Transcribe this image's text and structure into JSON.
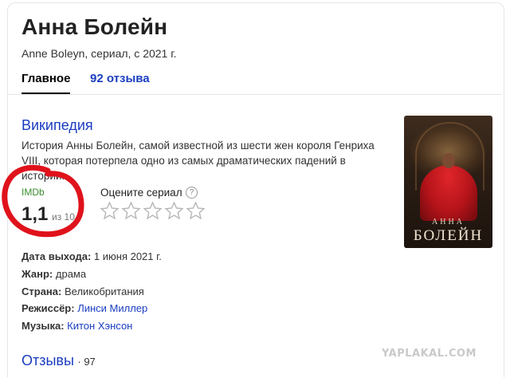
{
  "header": {
    "title": "Анна Болейн",
    "subtitle": "Anne Boleyn, сериал, с 2021 г."
  },
  "tabs": [
    {
      "label": "Главное",
      "active": true
    },
    {
      "label": "92 отзыва",
      "active": false
    }
  ],
  "wiki": {
    "link_label": "Википедия",
    "description": "История Анны Болейн, самой известной из шести жен короля Генриха VIII, которая потерпела одно из самых драматических падений в истории."
  },
  "poster": {
    "line1": "АННА",
    "line2": "БОЛЕЙН"
  },
  "rating": {
    "source": "IMDb",
    "score": "1,1",
    "out_of": "из 10"
  },
  "user_rating": {
    "label": "Оцените сериал",
    "help_icon": "question-circle-icon",
    "max_stars": 5,
    "selected": 0
  },
  "facts": [
    {
      "label": "Дата выхода:",
      "value": "1 июня 2021 г.",
      "link": false
    },
    {
      "label": "Жанр:",
      "value": "драма",
      "link": false
    },
    {
      "label": "Страна:",
      "value": "Великобритания",
      "link": false
    },
    {
      "label": "Режиссёр:",
      "value": "Линси Миллер",
      "link": true
    },
    {
      "label": "Музыка:",
      "value": "Китон Хэнсон",
      "link": true
    }
  ],
  "reviews": {
    "title": "Отзывы",
    "count": "· 97"
  },
  "watermark": "YAPLAKAL.COM",
  "colors": {
    "link": "#1a3dc1",
    "imdb": "#3a8a2e",
    "annotation": "#e0121b"
  }
}
